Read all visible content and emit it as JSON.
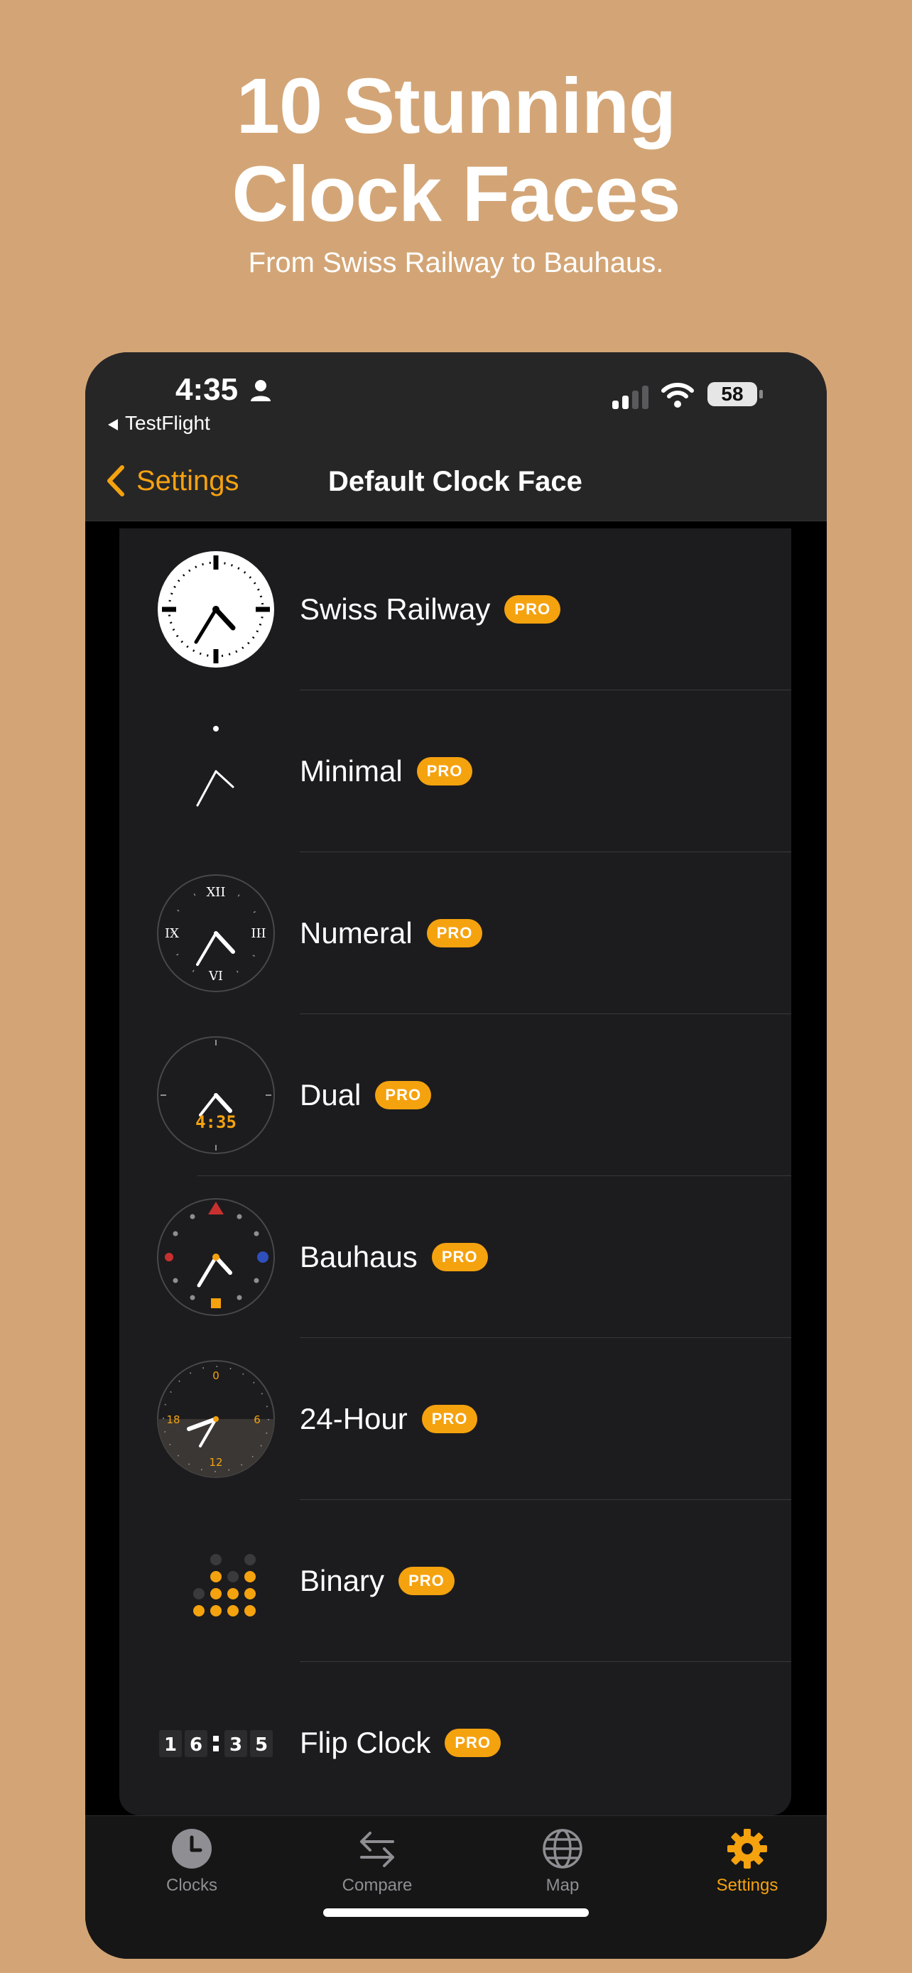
{
  "promo": {
    "title_line1": "10 Stunning",
    "title_line2": "Clock Faces",
    "subtitle": "From Swiss Railway to Bauhaus."
  },
  "status_bar": {
    "time": "4:35",
    "back_app": "TestFlight",
    "battery": "58"
  },
  "nav": {
    "back_label": "Settings",
    "title": "Default Clock Face"
  },
  "faces": [
    {
      "name": "Swiss Railway",
      "badge": "PRO"
    },
    {
      "name": "Minimal",
      "badge": "PRO"
    },
    {
      "name": "Numeral",
      "badge": "PRO"
    },
    {
      "name": "Dual",
      "badge": "PRO"
    },
    {
      "name": "Bauhaus",
      "badge": "PRO"
    },
    {
      "name": "24-Hour",
      "badge": "PRO"
    },
    {
      "name": "Binary",
      "badge": "PRO"
    },
    {
      "name": "Flip Clock",
      "badge": "PRO"
    }
  ],
  "thumb_text": {
    "numeral_12": "XII",
    "numeral_3": "III",
    "numeral_6": "VI",
    "numeral_9": "IX",
    "dual_time": "4:35",
    "h24_0": "0",
    "h24_6": "6",
    "h24_12": "12",
    "h24_18": "18",
    "flip_d1": "1",
    "flip_d2": "6",
    "flip_d3": "3",
    "flip_d4": "5"
  },
  "tabs": [
    {
      "label": "Clocks",
      "icon": "clock-icon"
    },
    {
      "label": "Compare",
      "icon": "arrows-icon"
    },
    {
      "label": "Map",
      "icon": "globe-icon"
    },
    {
      "label": "Settings",
      "icon": "gear-icon",
      "active": true
    }
  ],
  "colors": {
    "background": "#d3a576",
    "accent": "#f5a20f",
    "panel": "#1c1c1e"
  }
}
